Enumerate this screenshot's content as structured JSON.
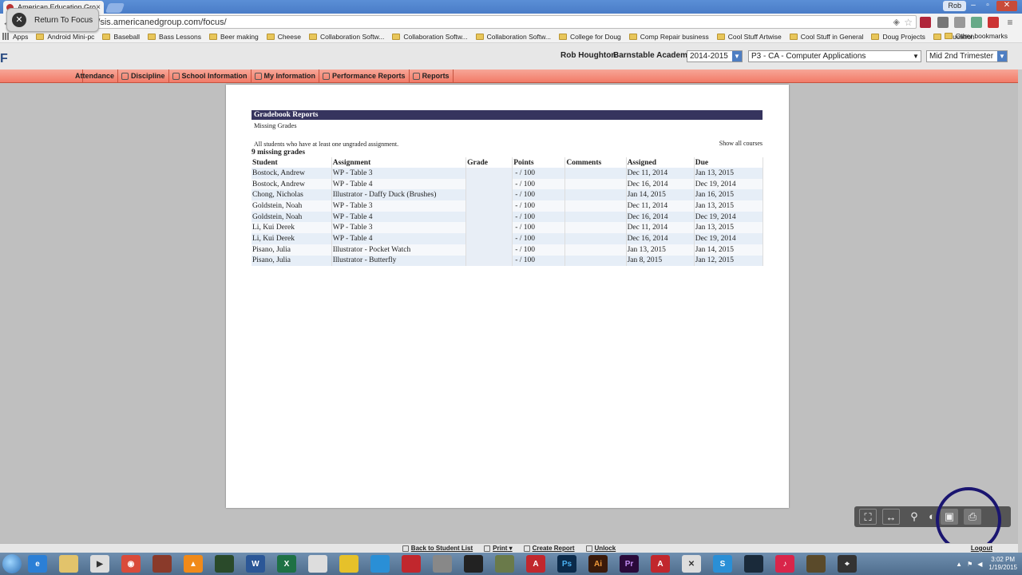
{
  "browser": {
    "tab_title": "American Education Grou",
    "user_chip": "Rob",
    "url": "https://sis.americanedgroup.com/focus/",
    "bookmarks": [
      {
        "label": "Apps",
        "type": "apps"
      },
      {
        "label": "Android Mini-pc",
        "type": "folder"
      },
      {
        "label": "Baseball",
        "type": "folder"
      },
      {
        "label": "Bass Lessons",
        "type": "folder"
      },
      {
        "label": "Beer making",
        "type": "folder"
      },
      {
        "label": "Cheese",
        "type": "folder"
      },
      {
        "label": "Collaboration Softw...",
        "type": "folder"
      },
      {
        "label": "Collaboration Softw...",
        "type": "folder"
      },
      {
        "label": "Collaboration Softw...",
        "type": "folder"
      },
      {
        "label": "College for Doug",
        "type": "folder"
      },
      {
        "label": "Comp Repair business",
        "type": "folder"
      },
      {
        "label": "Cool Stuff Artwise",
        "type": "folder"
      },
      {
        "label": "Cool Stuff in General",
        "type": "folder"
      },
      {
        "label": "Doug Projects",
        "type": "folder"
      },
      {
        "label": "Education",
        "type": "folder"
      }
    ],
    "bookmarks_more": "»",
    "other_bookmarks": "Other bookmarks"
  },
  "app_header": {
    "return_label": "Return To Focus",
    "user_name": "Rob Houghton",
    "school": "Barnstable Academy",
    "year": "2014-2015",
    "course": "P3 - CA - Computer Applications",
    "term": "Mid 2nd Trimester"
  },
  "menu": [
    {
      "label": "Attendance",
      "id": "attendance"
    },
    {
      "label": "Discipline",
      "id": "discipline"
    },
    {
      "label": "School Information",
      "id": "school-information"
    },
    {
      "label": "My Information",
      "id": "my-information"
    },
    {
      "label": "Performance Reports",
      "id": "performance-reports"
    },
    {
      "label": "Reports",
      "id": "reports"
    }
  ],
  "report": {
    "title": "Gradebook Reports",
    "subtitle": "Missing Grades",
    "description": "All students who have at least one ungraded assignment.",
    "show_all": "Show all courses",
    "count_label": "9 missing grades",
    "columns": [
      "Student",
      "Assignment",
      "Grade",
      "Points",
      "Comments",
      "Assigned",
      "Due"
    ],
    "rows": [
      {
        "student": "Bostock, Andrew",
        "assignment": "WP - Table 3",
        "grade": "",
        "points": "-  /  100",
        "comments": "",
        "assigned": "Dec 11, 2014",
        "due": "Jan 13, 2015"
      },
      {
        "student": "Bostock, Andrew",
        "assignment": "WP - Table 4",
        "grade": "",
        "points": "-  /  100",
        "comments": "",
        "assigned": "Dec 16, 2014",
        "due": "Dec 19, 2014"
      },
      {
        "student": "Chong, Nicholas",
        "assignment": "Illustrator - Daffy Duck (Brushes)",
        "grade": "",
        "points": "-  /  100",
        "comments": "",
        "assigned": "Jan 14, 2015",
        "due": "Jan 16, 2015"
      },
      {
        "student": "Goldstein, Noah",
        "assignment": "WP - Table 3",
        "grade": "",
        "points": "-  /  100",
        "comments": "",
        "assigned": "Dec 11, 2014",
        "due": "Jan 13, 2015"
      },
      {
        "student": "Goldstein, Noah",
        "assignment": "WP - Table 4",
        "grade": "",
        "points": "-  /  100",
        "comments": "",
        "assigned": "Dec 16, 2014",
        "due": "Dec 19, 2014"
      },
      {
        "student": "Li, Kui Derek",
        "assignment": "WP - Table 3",
        "grade": "",
        "points": "-  /  100",
        "comments": "",
        "assigned": "Dec 11, 2014",
        "due": "Jan 13, 2015"
      },
      {
        "student": "Li, Kui Derek",
        "assignment": "WP - Table 4",
        "grade": "",
        "points": "-  /  100",
        "comments": "",
        "assigned": "Dec 16, 2014",
        "due": "Dec 19, 2014"
      },
      {
        "student": "Pisano, Julia",
        "assignment": "Illustrator - Pocket Watch",
        "grade": "",
        "points": "-  /  100",
        "comments": "",
        "assigned": "Jan 13, 2015",
        "due": "Jan 14, 2015"
      },
      {
        "student": "Pisano, Julia",
        "assignment": "Illustrator - Butterfly",
        "grade": "",
        "points": "-  /  100",
        "comments": "",
        "assigned": "Jan 8, 2015",
        "due": "Jan 12, 2015"
      }
    ]
  },
  "viewer_controls": [
    "fullscreen-icon",
    "fit-width-icon",
    "zoom-in-icon",
    "zoom-out-icon",
    "save-icon",
    "print-icon"
  ],
  "footer": {
    "back": "Back to Student List",
    "print": "Print",
    "create_report": "Create Report",
    "unlock": "Unlock",
    "logout": "Logout"
  },
  "taskbar": {
    "time": "3:02 PM",
    "date": "1/19/2015"
  },
  "colors": {
    "header_bar": "#36345e",
    "menu_bar": "#f27b68",
    "row_alt": "#e6eef7",
    "ring": "#1a1570"
  }
}
